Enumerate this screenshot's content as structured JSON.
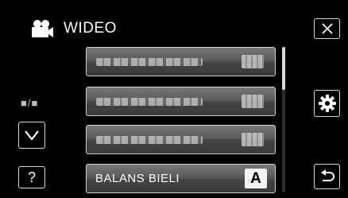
{
  "header": {
    "icon": "video-camera-icon",
    "title": "WIDEO"
  },
  "mode_indicator": "■/■",
  "menu": {
    "items": [
      {
        "label": "",
        "blurred": true
      },
      {
        "label": "",
        "blurred": true
      },
      {
        "label": "",
        "blurred": true
      },
      {
        "label": "BALANS BIELI",
        "value": "A"
      }
    ]
  },
  "buttons": {
    "close_icon": "close-icon",
    "settings_icon": "gear-icon",
    "back_icon": "return-icon",
    "down_icon": "chevron-down-icon",
    "help_label": "?"
  },
  "colors": {
    "background": "#000000",
    "item_border": "#d0d0d0",
    "text": "#ffffff"
  }
}
